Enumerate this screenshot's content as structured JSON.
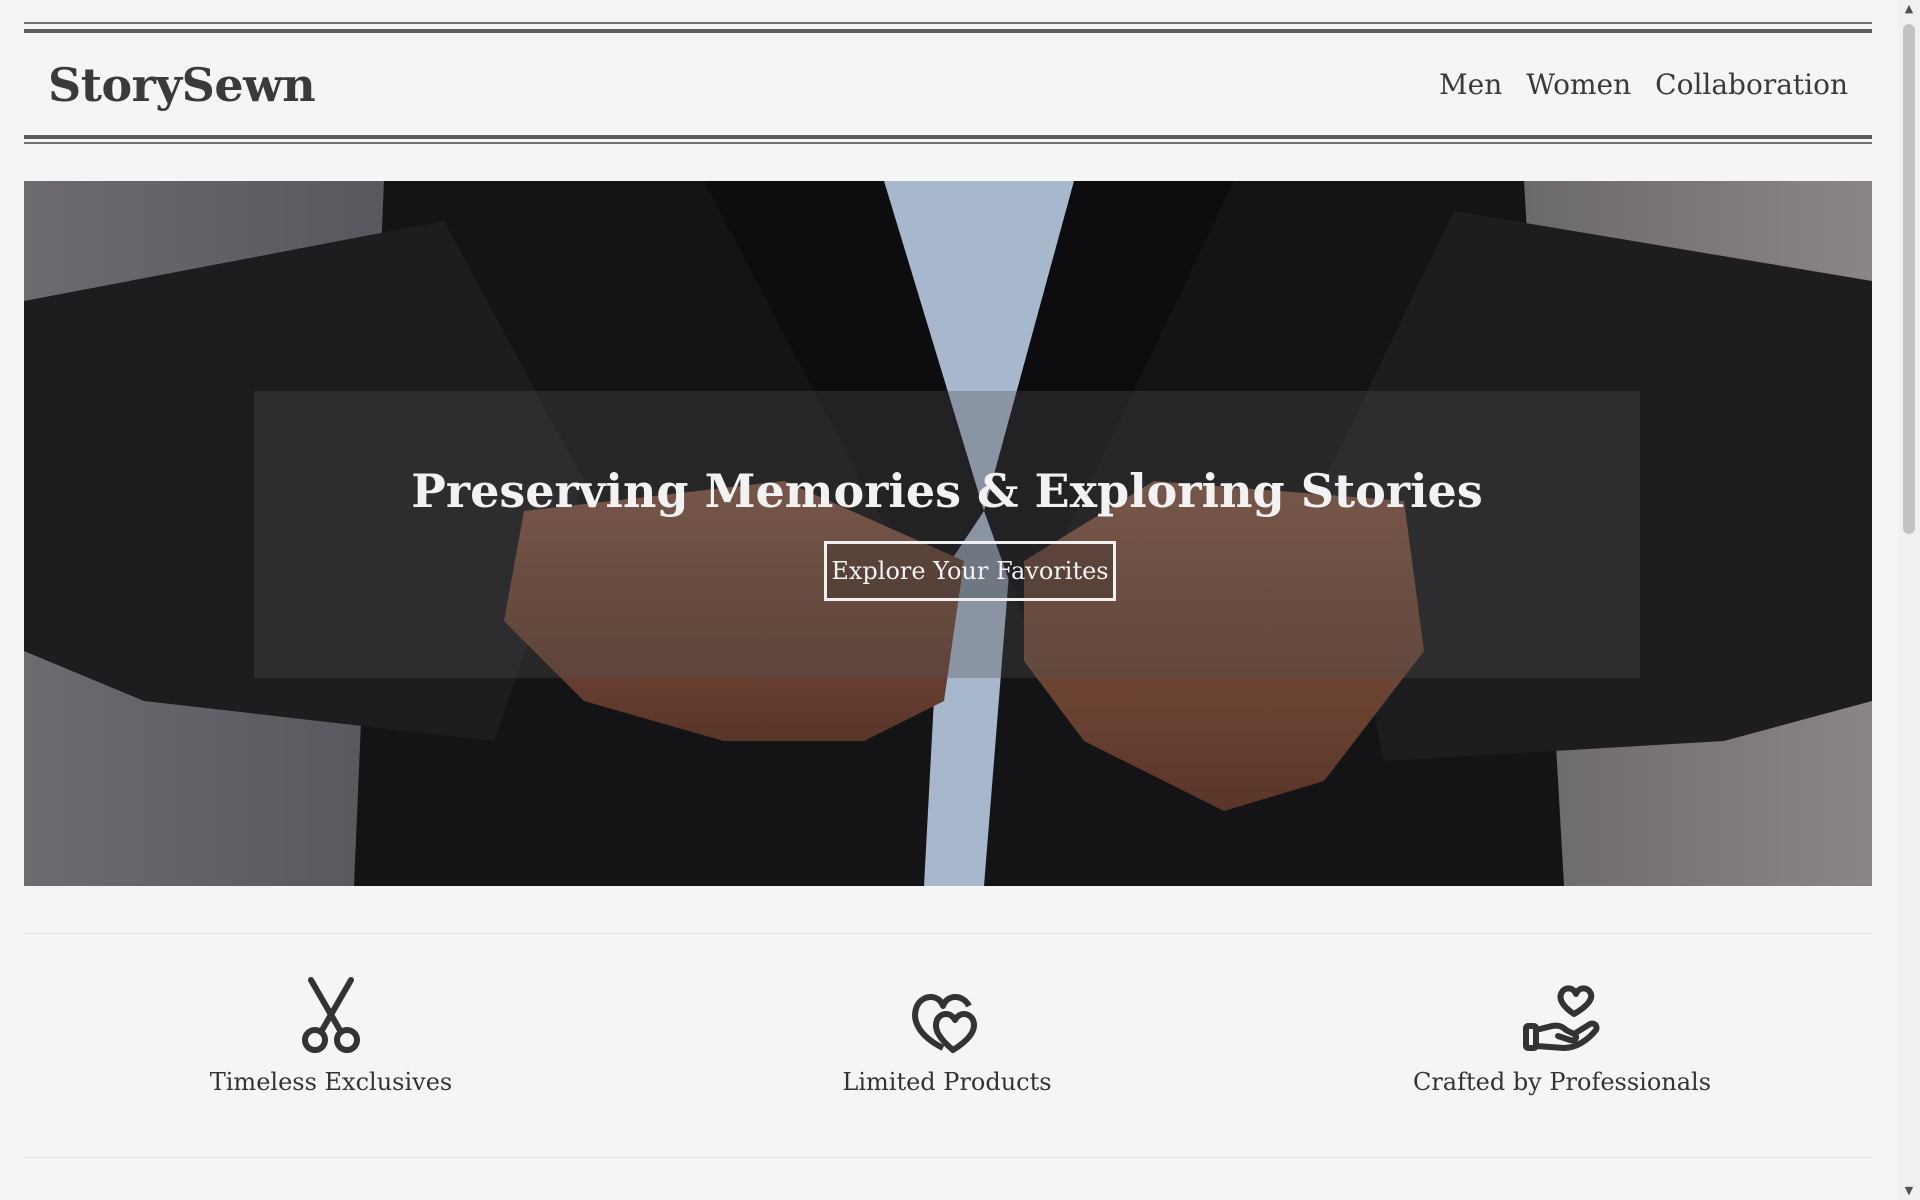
{
  "header": {
    "logo": "StorySewn",
    "nav": [
      {
        "label": "Men"
      },
      {
        "label": "Women"
      },
      {
        "label": "Collaboration"
      }
    ]
  },
  "hero": {
    "title": "Preserving Memories & Exploring Stories",
    "cta_label": "Explore Your Favorites"
  },
  "features": [
    {
      "icon": "scissors-icon",
      "label": "Timeless Exclusives"
    },
    {
      "icon": "hearts-icon",
      "label": "Limited Products"
    },
    {
      "icon": "hand-heart-icon",
      "label": "Crafted by Professionals"
    }
  ],
  "colors": {
    "background": "#f5f5f5",
    "text": "#333333",
    "hero_dark": "#1c1c1e"
  }
}
